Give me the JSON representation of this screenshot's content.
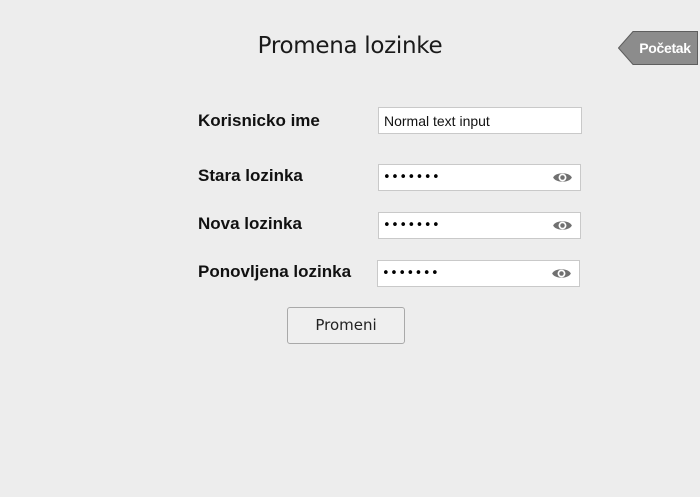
{
  "page": {
    "title": "Promena lozinke",
    "home_button": "Početak"
  },
  "form": {
    "username": {
      "label": "Korisnicko ime",
      "value": "Normal text input"
    },
    "old_password": {
      "label": "Stara lozinka",
      "masked_value": "•••••••"
    },
    "new_password": {
      "label": "Nova lozinka",
      "masked_value": "•••••••"
    },
    "repeat_password": {
      "label": "Ponovljena lozinka",
      "masked_value": "•••••••"
    },
    "submit_label": "Promeni"
  },
  "icons": {
    "reveal_password": "eye-icon"
  },
  "colors": {
    "background": "#ededed",
    "home_button": "#8c8c8c",
    "eye_icon": "#707070"
  }
}
